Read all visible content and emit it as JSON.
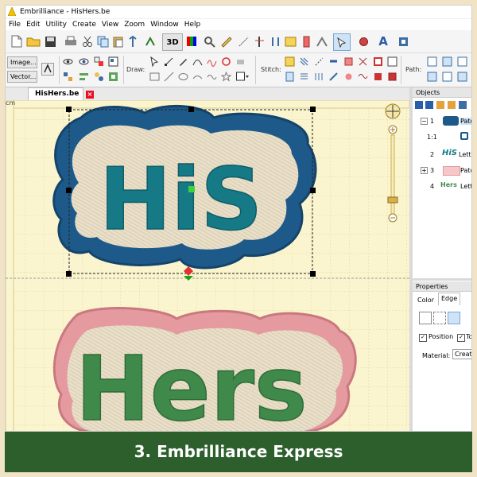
{
  "window": {
    "title": "Embrilliance - HisHers.be",
    "menu": [
      "File",
      "Edit",
      "Utility",
      "Create",
      "View",
      "Zoom",
      "Window",
      "Help"
    ]
  },
  "toolbar": {
    "threed_label": "3D",
    "image_button": "Image...",
    "vector_button": "Vector...",
    "draw_label": "Draw:",
    "stitch_label": "Stitch:",
    "path_label": "Path:"
  },
  "document": {
    "tab_label": "HisHers.be",
    "close_glyph": "×",
    "ruler_unit": "cm",
    "design_top_text": "HiS",
    "design_bottom_text": "Hers"
  },
  "objects_panel": {
    "header": "Objects",
    "rows": [
      {
        "num": "1",
        "label": "Patch"
      },
      {
        "num": "1:1",
        "label": ""
      },
      {
        "num": "2",
        "label": "Letter"
      },
      {
        "num": "3",
        "label": "Patch"
      },
      {
        "num": "4",
        "label": "Letter"
      }
    ]
  },
  "properties_panel": {
    "header": "Properties",
    "tabs": [
      "Color",
      "Edge"
    ],
    "position_label": "Position",
    "top_label": "Top",
    "material_label": "Material:",
    "material_value": "Create u"
  },
  "caption": "3. Embrilliance Express",
  "colors": {
    "his_patch_border": "#1d5a8a",
    "his_letters": "#157a86",
    "hers_patch_border": "#e59aa0",
    "hers_letters": "#3f8a4a",
    "fabric": "#e9dfc9",
    "canvas": "#fbf5cf",
    "banner": "#2c5f2c"
  }
}
